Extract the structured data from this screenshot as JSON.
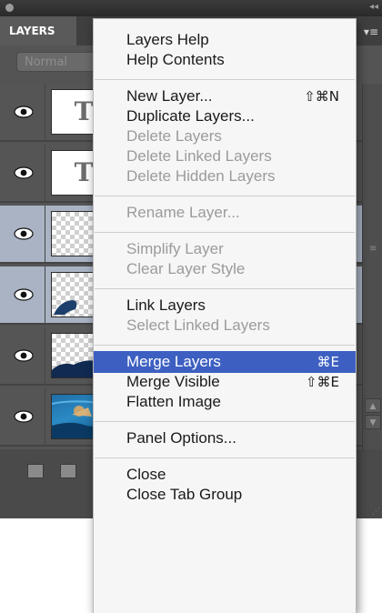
{
  "panel": {
    "tab_label": "LAYERS",
    "blend_mode": "Normal",
    "collapse_glyph": "◂◂",
    "menu_glyph": "▾≡",
    "layers": [
      {
        "thumb": "T",
        "type": "text",
        "selected": false
      },
      {
        "thumb": "T",
        "type": "text",
        "selected": false
      },
      {
        "thumb": "",
        "type": "transparent",
        "selected": true
      },
      {
        "thumb": "",
        "type": "dolphin",
        "selected": true
      },
      {
        "thumb": "",
        "type": "silhouette",
        "selected": false
      },
      {
        "thumb": "",
        "type": "photo",
        "selected": false
      }
    ]
  },
  "menu": {
    "groups": [
      [
        {
          "label": "Layers Help",
          "enabled": true
        },
        {
          "label": "Help Contents",
          "enabled": true
        }
      ],
      [
        {
          "label": "New Layer...",
          "shortcut": "⇧⌘N",
          "enabled": true
        },
        {
          "label": "Duplicate Layers...",
          "enabled": true
        },
        {
          "label": "Delete Layers",
          "enabled": false
        },
        {
          "label": "Delete Linked Layers",
          "enabled": false
        },
        {
          "label": "Delete Hidden Layers",
          "enabled": false
        }
      ],
      [
        {
          "label": "Rename Layer...",
          "enabled": false
        }
      ],
      [
        {
          "label": "Simplify Layer",
          "enabled": false
        },
        {
          "label": "Clear Layer Style",
          "enabled": false
        }
      ],
      [
        {
          "label": "Link Layers",
          "enabled": true
        },
        {
          "label": "Select Linked Layers",
          "enabled": false
        }
      ],
      [
        {
          "label": "Merge Layers",
          "shortcut": "⌘E",
          "enabled": true,
          "highlighted": true
        },
        {
          "label": "Merge Visible",
          "shortcut": "⇧⌘E",
          "enabled": true
        },
        {
          "label": "Flatten Image",
          "enabled": true
        }
      ],
      [
        {
          "label": "Panel Options...",
          "enabled": true
        }
      ],
      [
        {
          "label": "Close",
          "enabled": true
        },
        {
          "label": "Close Tab Group",
          "enabled": true
        }
      ]
    ]
  },
  "colors": {
    "highlight": "#3d5fc1",
    "selected_row": "#a9b3c4",
    "panel_bg": "#545454"
  }
}
